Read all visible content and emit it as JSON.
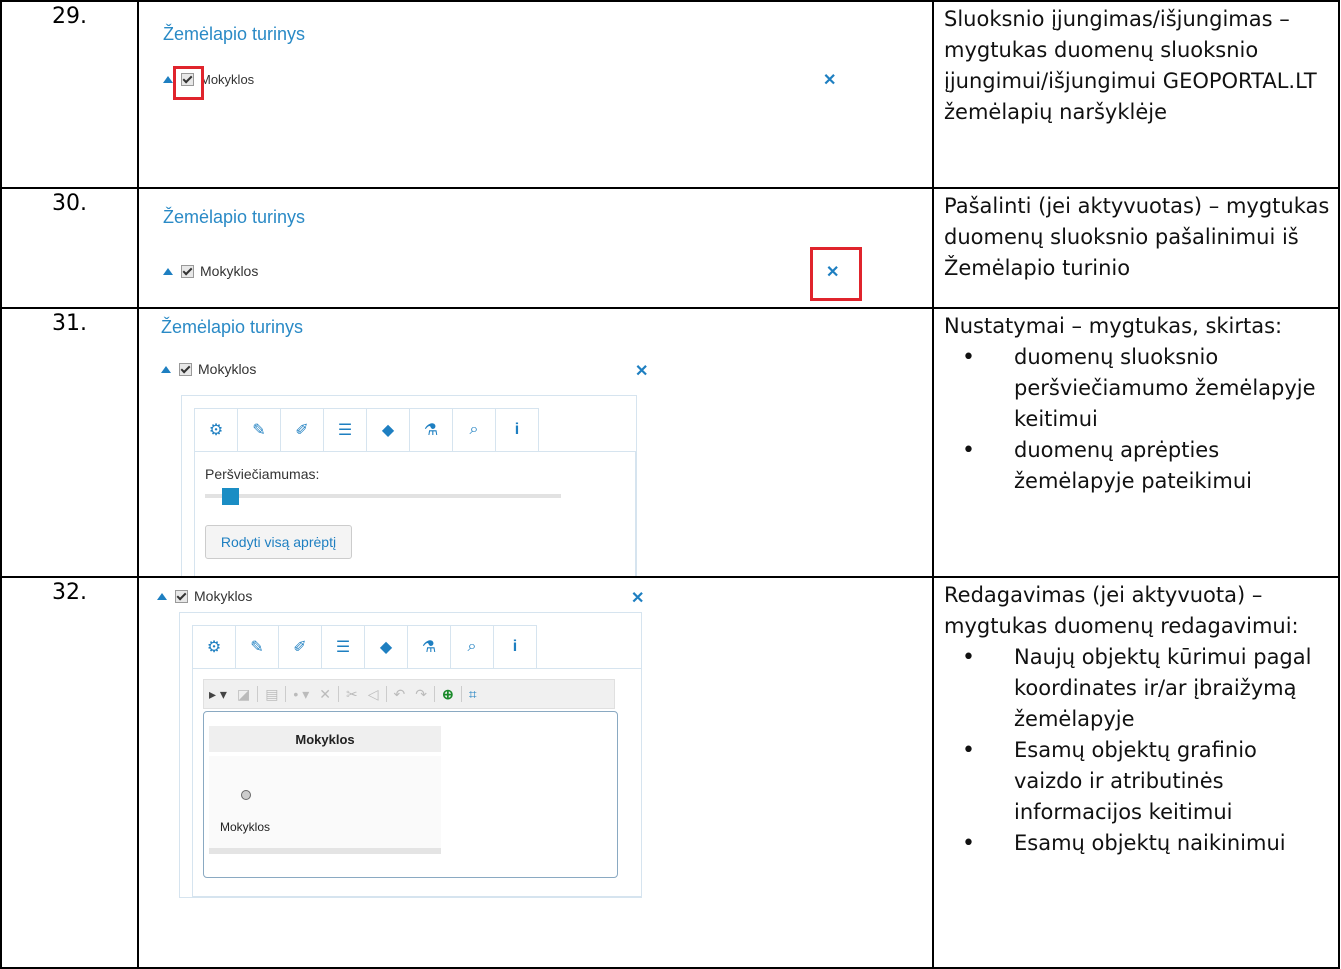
{
  "rows": [
    {
      "num": "29.",
      "map_title": "Žemėlapio turinys",
      "layer": "Mokyklos",
      "desc": "Sluoksnio įjungimas/išjungimas – mygtukas duomenų sluoksnio įjungimui/išjungimui GEOPORTAL.LT žemėlapių naršyklėje"
    },
    {
      "num": "30.",
      "map_title": "Žemėlapio turinys",
      "layer": "Mokyklos",
      "desc": "Pašalinti (jei aktyvuotas) – mygtukas duomenų sluoksnio pašalinimui iš Žemėlapio turinio"
    },
    {
      "num": "31.",
      "map_title": "Žemėlapio turinys",
      "layer": "Mokyklos",
      "transparency_label": "Peršviečiamumas:",
      "transparency_value": 0.05,
      "extent_button": "Rodyti visą aprėptį",
      "desc_intro": "Nustatymai – mygtukas, skirtas:",
      "desc_items": [
        "duomenų sluoksnio peršviečiamumo žemėlapyje keitimui",
        "duomenų aprėpties žemėlapyje pateikimui"
      ]
    },
    {
      "num": "32.",
      "layer": "Mokyklos",
      "attr_header": "Mokyklos",
      "legend_label": "Mokyklos",
      "desc_intro": "Redagavimas (jei aktyvuota) – mygtukas duomenų redagavimui:",
      "desc_items": [
        "Naujų objektų kūrimui pagal koordinates ir/ar įbraižymą žemėlapyje",
        "Esamų objektų grafinio vaizdo ir atributinės informacijos keitimui",
        "Esamų objektų naikinimui"
      ]
    }
  ],
  "icons": {
    "expand": "triangle-up-icon",
    "checkbox": "checkbox-checked-icon",
    "remove": "close-icon",
    "tabs": [
      "settings-icon",
      "pencil-icon",
      "eyedropper-icon",
      "list-icon",
      "tags-icon",
      "flask-icon",
      "search-icon",
      "info-icon"
    ]
  },
  "colors": {
    "link_blue": "#2a8ac6",
    "icon_blue": "#1e7fc1",
    "highlight_red": "#e0242c",
    "slider_blue": "#1a8dc4"
  }
}
